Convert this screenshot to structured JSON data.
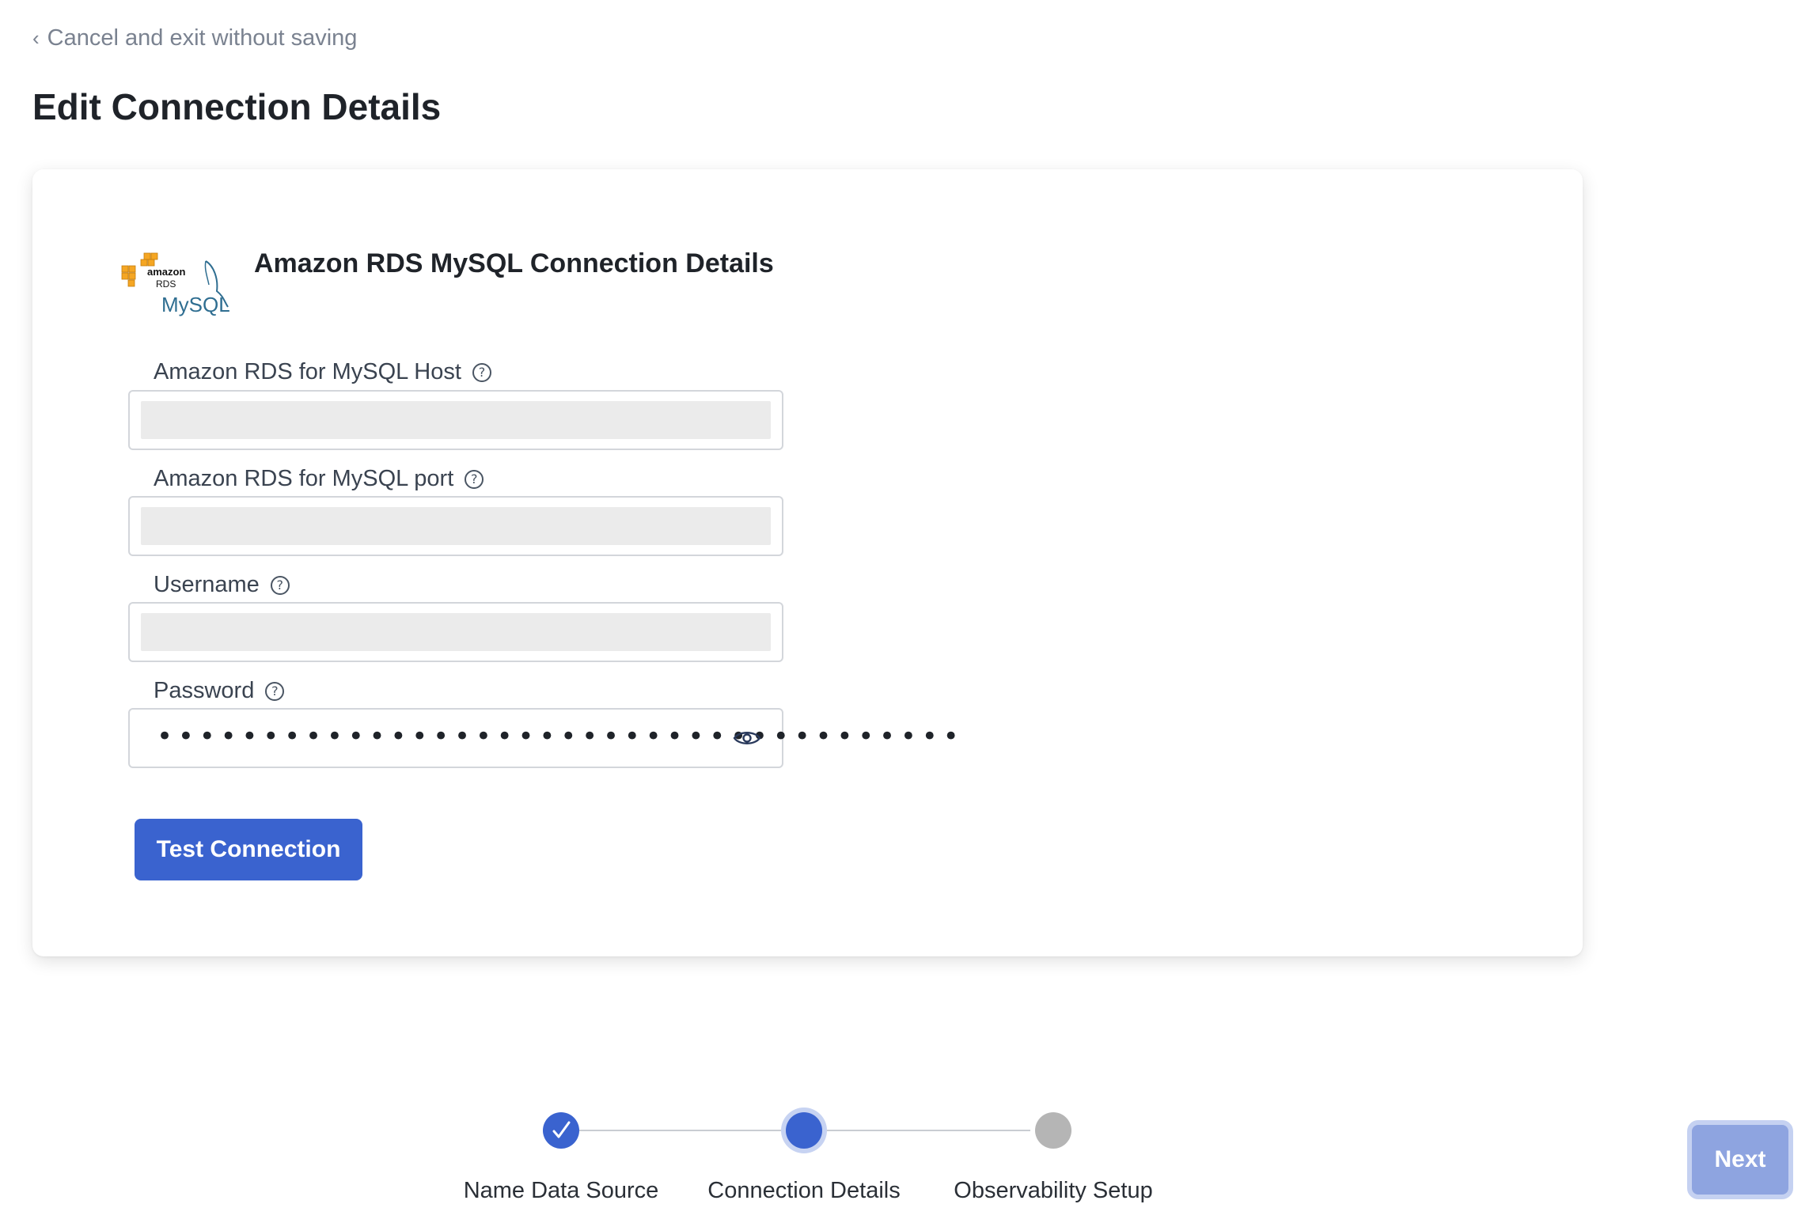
{
  "header": {
    "cancel_label": "Cancel and exit without saving",
    "page_title": "Edit Connection Details"
  },
  "card": {
    "logo_text": {
      "amazon": "amazon",
      "rds": "RDS",
      "mysql": "MySQL"
    },
    "title": "Amazon RDS MySQL Connection Details",
    "fields": [
      {
        "label": "Amazon RDS for MySQL Host",
        "value": ""
      },
      {
        "label": "Amazon RDS for MySQL port",
        "value": ""
      },
      {
        "label": "Username",
        "value": ""
      },
      {
        "label": "Password",
        "value": "••••••••••••••••••••••••••••••••••••••"
      }
    ],
    "help_glyph": "?",
    "test_button_label": "Test Connection"
  },
  "stepper": {
    "steps": [
      {
        "label": "Name Data Source",
        "state": "completed"
      },
      {
        "label": "Connection Details",
        "state": "active"
      },
      {
        "label": "Observability Setup",
        "state": "pending"
      }
    ]
  },
  "footer": {
    "next_label": "Next"
  },
  "colors": {
    "primary": "#3a63cf",
    "next_disabled": "#8ea4e0",
    "pending_step": "#b5b5b5",
    "aws_orange": "#f5a623",
    "mysql_blue": "#2f6e91"
  },
  "icons": {
    "back": "chevron-left-icon",
    "help": "question-circle-icon",
    "show_password": "eye-icon",
    "completed_step": "checkmark-icon"
  }
}
